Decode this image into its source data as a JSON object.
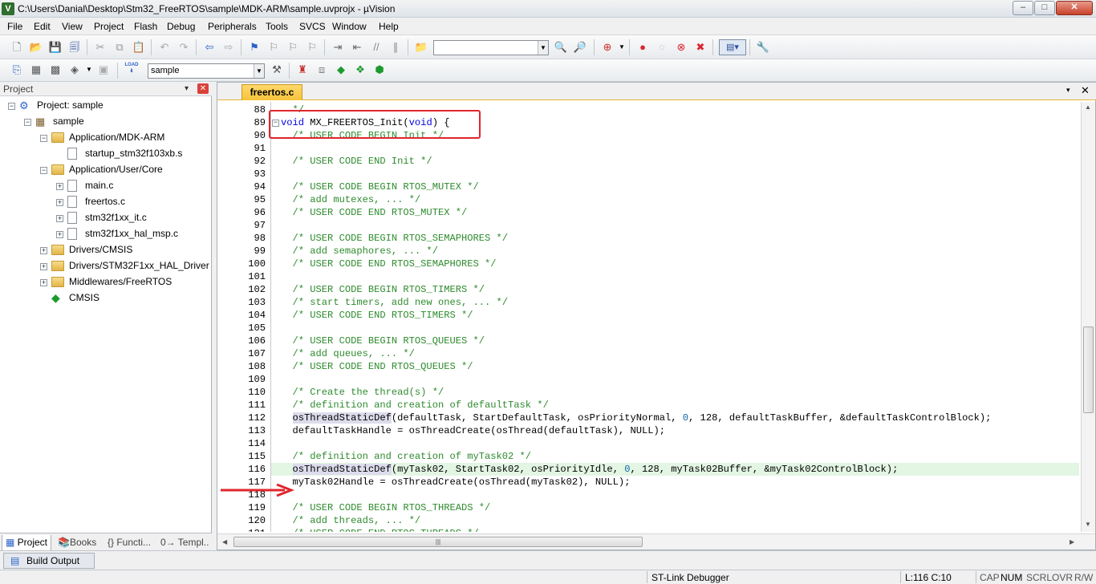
{
  "window": {
    "title": "C:\\Users\\Danial\\Desktop\\Stm32_FreeRTOS\\sample\\MDK-ARM\\sample.uvprojx - µVision",
    "app_icon_letter": "V",
    "min": "–",
    "max": "□",
    "close": "✕"
  },
  "menu": [
    "File",
    "Edit",
    "View",
    "Project",
    "Flash",
    "Debug",
    "Peripherals",
    "Tools",
    "SVCS",
    "Window",
    "Help"
  ],
  "toolbar": {
    "find_value": "",
    "target_combo": "sample",
    "load_label": "LOAD"
  },
  "project_panel": {
    "title": "Project",
    "pin": "▾",
    "close": "✕",
    "tree": [
      {
        "label": "Project: sample",
        "level": 0,
        "icon": "project",
        "expander": "−"
      },
      {
        "label": "sample",
        "level": 1,
        "icon": "target",
        "expander": "−"
      },
      {
        "label": "Application/MDK-ARM",
        "level": 2,
        "icon": "folder",
        "expander": "−"
      },
      {
        "label": "startup_stm32f103xb.s",
        "level": 3,
        "icon": "file",
        "expander": ""
      },
      {
        "label": "Application/User/Core",
        "level": 2,
        "icon": "folder",
        "expander": "−"
      },
      {
        "label": "main.c",
        "level": 3,
        "icon": "file",
        "expander": "+"
      },
      {
        "label": "freertos.c",
        "level": 3,
        "icon": "file",
        "expander": "+"
      },
      {
        "label": "stm32f1xx_it.c",
        "level": 3,
        "icon": "file",
        "expander": "+"
      },
      {
        "label": "stm32f1xx_hal_msp.c",
        "level": 3,
        "icon": "file",
        "expander": "+"
      },
      {
        "label": "Drivers/CMSIS",
        "level": 2,
        "icon": "folder",
        "expander": "+"
      },
      {
        "label": "Drivers/STM32F1xx_HAL_Driver",
        "level": 2,
        "icon": "folder",
        "expander": "+"
      },
      {
        "label": "Middlewares/FreeRTOS",
        "level": 2,
        "icon": "folder",
        "expander": "+"
      },
      {
        "label": "CMSIS",
        "level": 2,
        "icon": "diamond",
        "expander": ""
      }
    ],
    "tabs": [
      "Project",
      "Books",
      "{} Functi...",
      "0→ Templ..."
    ]
  },
  "editor": {
    "tab": "freertos.c",
    "tab_menu": "▾",
    "tab_close": "✕",
    "highlighted_line": 116,
    "lines": [
      {
        "n": "88",
        "code": "  */",
        "cls": "cmt"
      },
      {
        "n": "89",
        "code": "void MX_FREERTOS_Init(void) {",
        "cls": "fn"
      },
      {
        "n": "90",
        "code": "  /* USER CODE BEGIN Init */",
        "cls": "cmt"
      },
      {
        "n": "91",
        "code": "",
        "cls": ""
      },
      {
        "n": "92",
        "code": "  /* USER CODE END Init */",
        "cls": "cmt"
      },
      {
        "n": "93",
        "code": "",
        "cls": ""
      },
      {
        "n": "94",
        "code": "  /* USER CODE BEGIN RTOS_MUTEX */",
        "cls": "cmt"
      },
      {
        "n": "95",
        "code": "  /* add mutexes, ... */",
        "cls": "cmt"
      },
      {
        "n": "96",
        "code": "  /* USER CODE END RTOS_MUTEX */",
        "cls": "cmt"
      },
      {
        "n": "97",
        "code": "",
        "cls": ""
      },
      {
        "n": "98",
        "code": "  /* USER CODE BEGIN RTOS_SEMAPHORES */",
        "cls": "cmt"
      },
      {
        "n": "99",
        "code": "  /* add semaphores, ... */",
        "cls": "cmt"
      },
      {
        "n": "100",
        "code": "  /* USER CODE END RTOS_SEMAPHORES */",
        "cls": "cmt"
      },
      {
        "n": "101",
        "code": "",
        "cls": ""
      },
      {
        "n": "102",
        "code": "  /* USER CODE BEGIN RTOS_TIMERS */",
        "cls": "cmt"
      },
      {
        "n": "103",
        "code": "  /* start timers, add new ones, ... */",
        "cls": "cmt"
      },
      {
        "n": "104",
        "code": "  /* USER CODE END RTOS_TIMERS */",
        "cls": "cmt"
      },
      {
        "n": "105",
        "code": "",
        "cls": ""
      },
      {
        "n": "106",
        "code": "  /* USER CODE BEGIN RTOS_QUEUES */",
        "cls": "cmt"
      },
      {
        "n": "107",
        "code": "  /* add queues, ... */",
        "cls": "cmt"
      },
      {
        "n": "108",
        "code": "  /* USER CODE END RTOS_QUEUES */",
        "cls": "cmt"
      },
      {
        "n": "109",
        "code": "",
        "cls": ""
      },
      {
        "n": "110",
        "code": "  /* Create the thread(s) */",
        "cls": "cmt"
      },
      {
        "n": "111",
        "code": "  /* definition and creation of defaultTask */",
        "cls": "cmt"
      },
      {
        "n": "112",
        "code": "  osThreadStaticDef(defaultTask, StartDefaultTask, osPriorityNormal, 0, 128, defaultTaskBuffer, &defaultTaskControlBlock);",
        "cls": "def"
      },
      {
        "n": "113",
        "code": "  defaultTaskHandle = osThreadCreate(osThread(defaultTask), NULL);",
        "cls": ""
      },
      {
        "n": "114",
        "code": "",
        "cls": ""
      },
      {
        "n": "115",
        "code": "  /* definition and creation of myTask02 */",
        "cls": "cmt"
      },
      {
        "n": "116",
        "code": "  osThreadStaticDef(myTask02, StartTask02, osPriorityIdle, 0, 128, myTask02Buffer, &myTask02ControlBlock);",
        "cls": "def"
      },
      {
        "n": "117",
        "code": "  myTask02Handle = osThreadCreate(osThread(myTask02), NULL);",
        "cls": ""
      },
      {
        "n": "118",
        "code": "",
        "cls": ""
      },
      {
        "n": "119",
        "code": "  /* USER CODE BEGIN RTOS_THREADS */",
        "cls": "cmt"
      },
      {
        "n": "120",
        "code": "  /* add threads, ... */",
        "cls": "cmt"
      },
      {
        "n": "121",
        "code": "  /* USER CODE END RTOS_THREADS */",
        "cls": "cmt"
      }
    ]
  },
  "build_output": {
    "label": "Build Output"
  },
  "status": {
    "debugger": "ST-Link Debugger",
    "position": "L:116 C:10",
    "cap": "CAP",
    "num": "NUM",
    "scrl": "SCRL",
    "ovr": "OVR",
    "rw": "R/W"
  },
  "colors": {
    "comment": "#2e8b2e",
    "keyword": "#0000e0",
    "number": "#0f66a8",
    "annotation_red": "#e0262e",
    "highlight_line": "#e3f5e3",
    "active_tab": "#f7c33a"
  }
}
